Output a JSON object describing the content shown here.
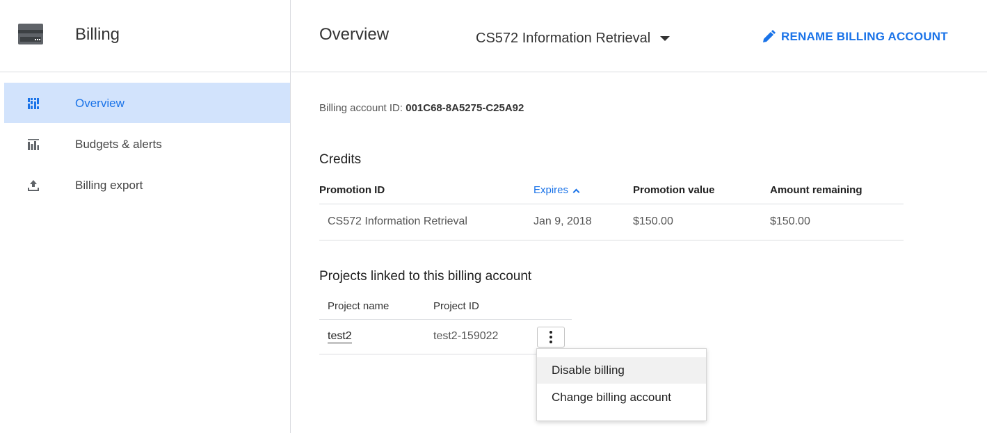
{
  "sidebar": {
    "title": "Billing",
    "items": [
      {
        "label": "Overview",
        "active": true
      },
      {
        "label": "Budgets & alerts",
        "active": false
      },
      {
        "label": "Billing export",
        "active": false
      }
    ]
  },
  "topbar": {
    "title": "Overview",
    "account_name": "CS572 Information Retrieval",
    "rename_label": "RENAME BILLING ACCOUNT"
  },
  "account": {
    "id_label": "Billing account ID: ",
    "id_value": "001C68-8A5275-C25A92"
  },
  "credits": {
    "heading": "Credits",
    "columns": [
      "Promotion ID",
      "Expires",
      "Promotion value",
      "Amount remaining"
    ],
    "rows": [
      [
        "CS572 Information Retrieval",
        "Jan 9, 2018",
        "$150.00",
        "$150.00"
      ]
    ]
  },
  "projects": {
    "heading": "Projects linked to this billing account",
    "columns": [
      "Project name",
      "Project ID"
    ],
    "rows": [
      [
        "test2",
        "test2-159022"
      ]
    ]
  },
  "menu": {
    "items": [
      "Disable billing",
      "Change billing account"
    ]
  },
  "colors": {
    "accent": "#1a73e8",
    "active_bg": "#d2e3fc"
  }
}
